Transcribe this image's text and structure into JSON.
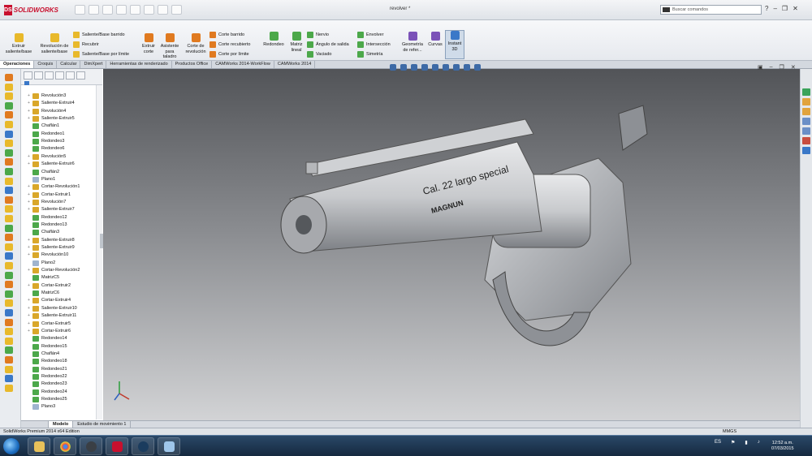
{
  "app": {
    "brand": "SOLIDWORKS",
    "doc_title": "revolver *"
  },
  "search": {
    "placeholder": "Buscar comandos"
  },
  "command_manager": {
    "big_buttons": [
      {
        "label": "Extruir saliente/base"
      },
      {
        "label": "Revolución de saliente/base"
      },
      {
        "label": "Extruir corte"
      },
      {
        "label": "Asistente para taladro"
      },
      {
        "label": "Corte de revolución"
      },
      {
        "label": "Redondeo"
      },
      {
        "label": "Matriz lineal"
      },
      {
        "label": "Geometría de refer..."
      },
      {
        "label": "Curvas"
      },
      {
        "label": "Instant 3D"
      }
    ],
    "small_buttons": [
      {
        "label": "Saliente/Base barrido"
      },
      {
        "label": "Recubrir"
      },
      {
        "label": "Saliente/Base por límite"
      },
      {
        "label": "Corte barrido"
      },
      {
        "label": "Corte recubierto"
      },
      {
        "label": "Corte por límite"
      },
      {
        "label": "Nervio"
      },
      {
        "label": "Ángulo de salida"
      },
      {
        "label": "Vaciado"
      },
      {
        "label": "Envolver"
      },
      {
        "label": "Intersección"
      },
      {
        "label": "Simetría"
      }
    ]
  },
  "tabs": [
    "Operaciones",
    "Croquis",
    "Calcular",
    "DimXpert",
    "Herramientas de renderizado",
    "Productos Office",
    "CAMWorks 2014-WorkFlow",
    "CAMWorks 2014"
  ],
  "feature_tree": [
    "Revolución3",
    "Saliente-Extruir4",
    "Revolución4",
    "Saliente-Extruir5",
    "Chaflán1",
    "Redondeo1",
    "Redondeo3",
    "Redondeo6",
    "Revolución5",
    "Saliente-Extruir6",
    "Chaflán2",
    "Plano1",
    "Cortar-Revolución1",
    "Cortar-Extruir1",
    "Revolución7",
    "Saliente-Extruir7",
    "Redondeo12",
    "Redondeo13",
    "Chaflán3",
    "Saliente-Extruir8",
    "Saliente-Extruir9",
    "Revolución10",
    "Plano2",
    "Cortar-Revolución2",
    "MatrizC5",
    "Cortar-Extruir2",
    "MatrizC6",
    "Cortar-Extruir4",
    "Saliente-Extruir10",
    "Saliente-Extruir11",
    "Cortar-Extruir5",
    "Cortar-Extruir6",
    "Redondeo14",
    "Redondeo15",
    "Chaflán4",
    "Redondeo18",
    "Redondeo21",
    "Redondeo22",
    "Redondeo23",
    "Redondeo24",
    "Redondeo25",
    "Plano3"
  ],
  "model": {
    "engraving_line1": "Cal. 22 largo special",
    "engraving_line2": "MAGNUN"
  },
  "bottom_tabs": [
    "Modelo",
    "Estudio de movimiento 1"
  ],
  "status": {
    "left": "SolidWorks Premium 2014 x64 Edition",
    "units": "MMGS"
  },
  "taskbar": {
    "lang": "ES",
    "time": "12:52 a.m.",
    "date": "07/03/2015"
  }
}
